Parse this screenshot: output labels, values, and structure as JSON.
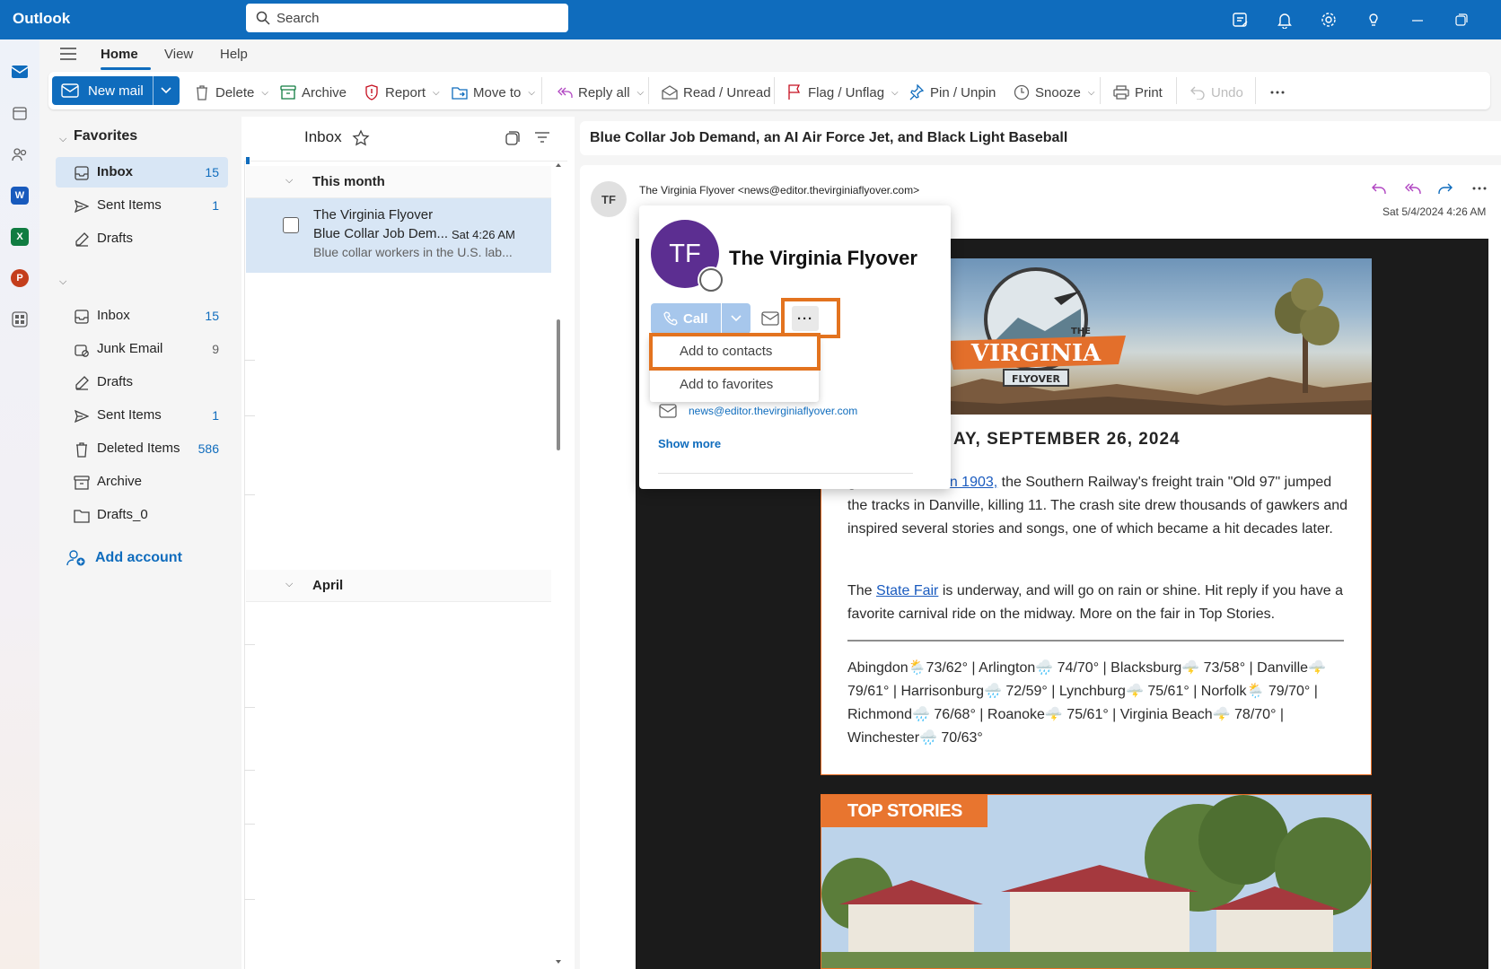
{
  "app": {
    "name": "Outlook"
  },
  "search": {
    "placeholder": "Search"
  },
  "ribbon": {
    "tabs": [
      "Home",
      "View",
      "Help"
    ],
    "new_mail": "New mail",
    "tools": {
      "delete": "Delete",
      "archive": "Archive",
      "report": "Report",
      "move_to": "Move to",
      "reply_all": "Reply all",
      "read_unread": "Read / Unread",
      "flag_unflag": "Flag / Unflag",
      "pin_unpin": "Pin / Unpin",
      "snooze": "Snooze",
      "print": "Print",
      "undo": "Undo"
    }
  },
  "folders": {
    "favorites_label": "Favorites",
    "favorites": [
      {
        "label": "Inbox",
        "count": "15"
      },
      {
        "label": "Sent Items",
        "count": "1"
      },
      {
        "label": "Drafts",
        "count": ""
      }
    ],
    "account": [
      {
        "label": "Inbox",
        "count": "15"
      },
      {
        "label": "Junk Email",
        "count": "9"
      },
      {
        "label": "Drafts",
        "count": ""
      },
      {
        "label": "Sent Items",
        "count": "1"
      },
      {
        "label": "Deleted Items",
        "count": "586"
      },
      {
        "label": "Archive",
        "count": ""
      },
      {
        "label": "Drafts_0",
        "count": ""
      }
    ],
    "add_account": "Add account"
  },
  "message_list": {
    "title": "Inbox",
    "groups": [
      "This month",
      "April"
    ],
    "items": [
      {
        "sender": "The Virginia Flyover",
        "subject": "Blue Collar Job Dem...",
        "time": "Sat 4:26 AM",
        "preview": "Blue collar workers in the U.S. lab..."
      }
    ]
  },
  "reading": {
    "subject": "Blue Collar Job Demand, an AI Air Force Jet, and Black Light Baseball",
    "from_initials": "TF",
    "from": "The Virginia Flyover <news@editor.thevirginiaflyover.com>",
    "date": "Sat 5/4/2024 4:26 AM",
    "newsletter": {
      "date_heading": "AY, SEPTEMBER 26, 2024",
      "p1_lead": "g!",
      "p1_link": "On this date in 1903,",
      "p1_rest": " the Southern Railway's freight train \"Old 97\" jumped the tracks in Danville, killing 11. The crash site drew thousands of gawkers and inspired several stories and songs, one of which became a hit decades later.",
      "p2_pre": "The ",
      "p2_link": "State Fair",
      "p2_rest": " is underway, and will go on rain or shine. Hit reply if you have a favorite carnival ride on the midway. More on the fair in Top Stories.",
      "weather": "Abingdon🌦️73/62° | Arlington🌧️ 74/70° | Blacksburg🌩️ 73/58° | Danville🌩️ 79/61° | Harrisonburg🌧️ 72/59° | Lynchburg🌩️ 75/61° | Norfolk🌦️ 79/70° | Richmond🌧️ 76/68° | Roanoke🌩️ 75/61° | Virginia Beach🌩️ 78/70° | Winchester🌧️ 70/63°",
      "logo_text_the": "THE",
      "logo_text_main": "VIRGINIA",
      "logo_text_sub": "FLYOVER",
      "top_stories": "TOP STORIES"
    }
  },
  "contact_card": {
    "initials": "TF",
    "name": "The Virginia Flyover",
    "call": "Call",
    "more": "···",
    "menu": [
      "Add to contacts",
      "Add to favorites"
    ],
    "email": "news@editor.thevirginiaflyover.com",
    "show_more": "Show more"
  },
  "colors": {
    "brand": "#0f6cbd",
    "highlight": "#e3731f",
    "avatar": "#5c2e91"
  }
}
